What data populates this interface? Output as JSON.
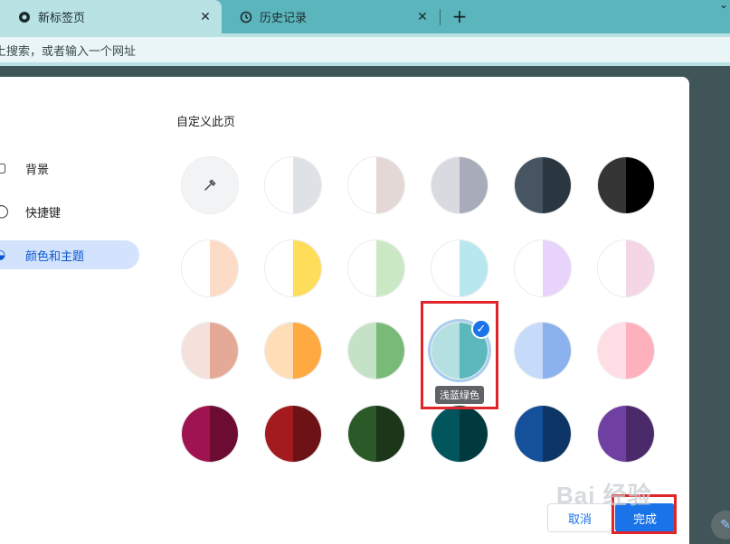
{
  "tabs": [
    {
      "label": "新标签页",
      "icon": "new-tab-icon",
      "active": true
    },
    {
      "label": "历史记录",
      "icon": "history-icon",
      "active": false
    }
  ],
  "omnibox": {
    "placeholder": "上搜索，或者输入一个网址"
  },
  "sidebar": {
    "items": [
      {
        "label": "背景",
        "icon": "background-icon",
        "selected": false
      },
      {
        "label": "快捷键",
        "icon": "shortcuts-icon",
        "selected": false
      },
      {
        "label": "颜色和主题",
        "icon": "palette-icon",
        "selected": true
      }
    ]
  },
  "main": {
    "title": "自定义此页",
    "selected_color_tooltip": "浅蓝绿色",
    "colors": [
      [
        "#f1f3f4",
        "#f1f3f4"
      ],
      [
        "#ffffff",
        "#dee1e6"
      ],
      [
        "#ffffff",
        "#e3d8d5"
      ],
      [
        "#d9dae0",
        "#a8abb9"
      ],
      [
        "#465561",
        "#2a3740"
      ],
      [
        "#353535",
        "#000000"
      ],
      [
        "#ffffff",
        "#fddcc7"
      ],
      [
        "#ffffff",
        "#fedd5a"
      ],
      [
        "#ffffff",
        "#cbe8c5"
      ],
      [
        "#ffffff",
        "#b8e7f0"
      ],
      [
        "#ffffff",
        "#e8d3fb"
      ],
      [
        "#ffffff",
        "#f5d6e4"
      ],
      [
        "#f4e1dc",
        "#e5aa97"
      ],
      [
        "#fddeb6",
        "#fea941"
      ],
      [
        "#c4e2c5",
        "#7aba79"
      ],
      [
        "#b5e0e2",
        "#5cb8bd"
      ],
      [
        "#c6dafa",
        "#8bb2ec"
      ],
      [
        "#fedde4",
        "#feb0bc"
      ],
      [
        "#9f1450",
        "#6c0c33"
      ],
      [
        "#a31a1f",
        "#6e1315"
      ],
      [
        "#2b5a28",
        "#1b3619"
      ],
      [
        "#01565d",
        "#003a3e"
      ],
      [
        "#15519b",
        "#0d3566"
      ],
      [
        "#6f3fa1",
        "#4b2a6c"
      ]
    ]
  },
  "buttons": {
    "cancel": "取消",
    "done": "完成"
  },
  "watermark": "Bai 经验"
}
